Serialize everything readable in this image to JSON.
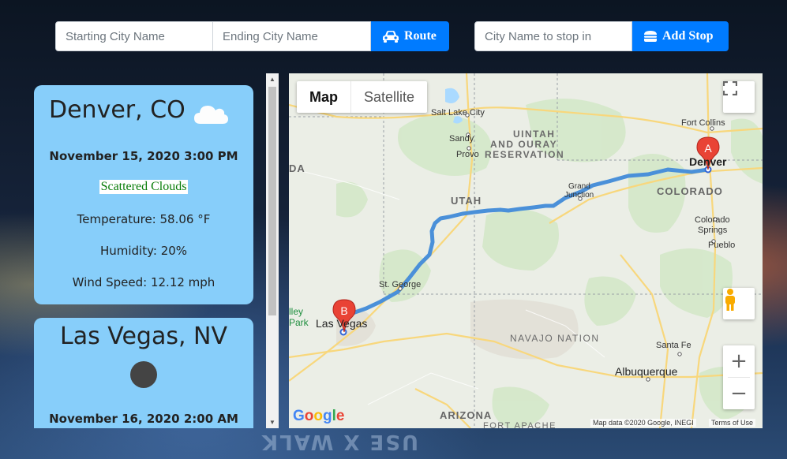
{
  "search": {
    "start_placeholder": "Starting City Name",
    "end_placeholder": "Ending City Name",
    "route_label": "Route",
    "stop_placeholder": "City Name to stop in",
    "add_stop_label": "Add Stop"
  },
  "weather_cards": [
    {
      "city": "Denver, CO",
      "icon": "cloud-icon",
      "date": "November 15, 2020 3:00 PM",
      "description": "Scattered Clouds",
      "temperature": "Temperature: 58.06 °F",
      "humidity": "Humidity: 20%",
      "wind": "Wind Speed: 12.12 mph"
    },
    {
      "city": "Las Vegas, NV",
      "icon": "dark-cloud-icon",
      "date": "November 16, 2020 2:00 AM"
    }
  ],
  "map": {
    "type_map": "Map",
    "type_satellite": "Satellite",
    "marker_a": "A",
    "marker_b": "B",
    "labels": {
      "salt_lake": "Salt Lake City",
      "sandy": "Sandy",
      "provo": "Provo",
      "uintah": "UINTAH",
      "ouray": "AND OURAY",
      "reservation": "RESERVATION",
      "fort_collins": "Fort Collins",
      "denver": "Denver",
      "colorado": "COLORADO",
      "colorado_springs_1": "Colorado",
      "colorado_springs_2": "Springs",
      "pueblo": "Pueblo",
      "grand_junction_1": "Grand",
      "grand_junction_2": "Junction",
      "utah": "UTAH",
      "st_george": "St. George",
      "las_vegas": "Las Vegas",
      "valley_1": "lley",
      "valley_2": "Park",
      "nevada": "DA",
      "navajo": "NAVAJO NATION",
      "santa_fe": "Santa Fe",
      "albuquerque": "Albuquerque",
      "arizona": "ARIZONA",
      "fort_apache": "FORT APACHE"
    },
    "google": "Google",
    "attribution": "Map data ©2020 Google, INEGI",
    "terms": "Terms of Use"
  },
  "colors": {
    "button": "#007bff",
    "card": "#87cefa",
    "route": "#4a90d9",
    "marker": "#e94335"
  }
}
